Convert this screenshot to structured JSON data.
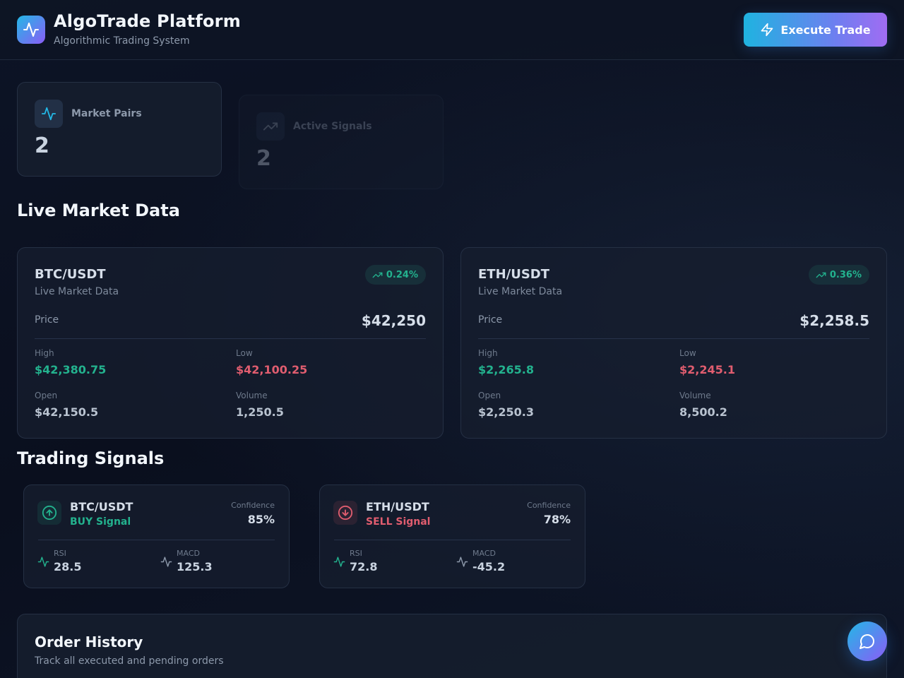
{
  "header": {
    "title": "AlgoTrade Platform",
    "subtitle": "Algorithmic Trading System",
    "execute_label": "Execute Trade"
  },
  "stats": [
    {
      "label": "Market Pairs",
      "value": "2",
      "icon": "activity-icon"
    },
    {
      "label": "Active Signals",
      "value": "2",
      "icon": "trending-up-icon"
    }
  ],
  "market_section": {
    "title": "Live Market Data",
    "cards": [
      {
        "pair": "BTC/USDT",
        "subtitle": "Live Market Data",
        "change": "0.24%",
        "price_label": "Price",
        "price": "$42,250",
        "high_label": "High",
        "high": "$42,380.75",
        "low_label": "Low",
        "low": "$42,100.25",
        "open_label": "Open",
        "open": "$42,150.5",
        "volume_label": "Volume",
        "volume": "1,250.5"
      },
      {
        "pair": "ETH/USDT",
        "subtitle": "Live Market Data",
        "change": "0.36%",
        "price_label": "Price",
        "price": "$2,258.5",
        "high_label": "High",
        "high": "$2,265.8",
        "low_label": "Low",
        "low": "$2,245.1",
        "open_label": "Open",
        "open": "$2,250.3",
        "volume_label": "Volume",
        "volume": "8,500.2"
      }
    ]
  },
  "signals_section": {
    "title": "Trading Signals",
    "cards": [
      {
        "pair": "BTC/USDT",
        "signal": "BUY Signal",
        "direction": "buy",
        "confidence_label": "Confidence",
        "confidence": "85%",
        "rsi_label": "RSI",
        "rsi": "28.5",
        "macd_label": "MACD",
        "macd": "125.3"
      },
      {
        "pair": "ETH/USDT",
        "signal": "SELL Signal",
        "direction": "sell",
        "confidence_label": "Confidence",
        "confidence": "78%",
        "rsi_label": "RSI",
        "rsi": "72.8",
        "macd_label": "MACD",
        "macd": "-45.2"
      }
    ]
  },
  "orders": {
    "title": "Order History",
    "subtitle": "Track all executed and pending orders"
  },
  "colors": {
    "accent_start": "#22b8e6",
    "accent_end": "#8b5cf6",
    "positive": "#23b28e",
    "negative": "#e05d6f",
    "background": "#0b1120"
  }
}
